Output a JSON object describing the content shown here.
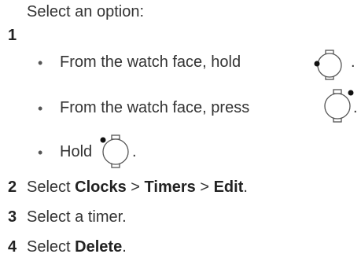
{
  "steps": [
    {
      "number": "1",
      "text": "Select an option:",
      "options": [
        {
          "bullet": "•",
          "text": "From the watch face, hold",
          "suffix": ".",
          "icon": "watch-button-left-icon"
        },
        {
          "bullet": "•",
          "text": "From the watch face, press",
          "suffix": ".",
          "icon": "watch-button-top-right-icon"
        },
        {
          "bullet": "•",
          "text": "Hold",
          "suffix": ".",
          "icon": "watch-button-top-left-icon"
        }
      ]
    },
    {
      "number": "2",
      "pre": "Select ",
      "b1": "Clocks",
      "sep1": " > ",
      "b2": "Timers",
      "sep2": " > ",
      "b3": "Edit",
      "end": "."
    },
    {
      "number": "3",
      "text": "Select a timer."
    },
    {
      "number": "4",
      "pre": "Select ",
      "b1": "Delete",
      "end": "."
    }
  ]
}
